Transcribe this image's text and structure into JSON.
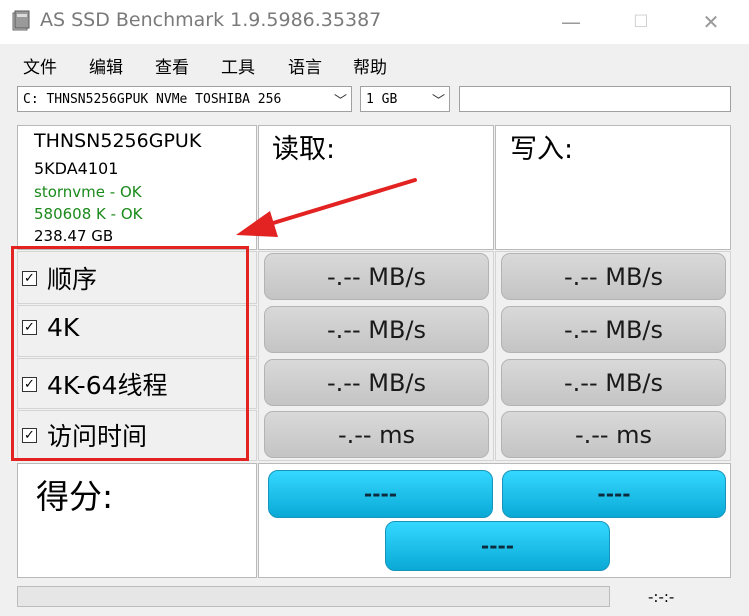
{
  "window": {
    "title": "AS SSD Benchmark 1.9.5986.35387",
    "minimize": "—",
    "maximize": "☐",
    "close": "✕"
  },
  "menu": [
    "文件",
    "编辑",
    "查看",
    "工具",
    "语言",
    "帮助"
  ],
  "toolbar": {
    "drive_select": "C: THNSN5256GPUK NVMe TOSHIBA 256",
    "size_select": "1 GB",
    "text_field": ""
  },
  "drive_info": {
    "model": "THNSN5256GPUK",
    "firmware": "5KDA4101",
    "driver_status": "stornvme - OK",
    "alignment_status": "580608 K - OK",
    "capacity": "238.47 GB"
  },
  "columns": {
    "read": "读取:",
    "write": "写入:"
  },
  "tests": [
    {
      "label": "顺序",
      "checked": true,
      "read": "-.-- MB/s",
      "write": "-.-- MB/s"
    },
    {
      "label": "4K",
      "checked": true,
      "read": "-.-- MB/s",
      "write": "-.-- MB/s"
    },
    {
      "label": "4K-64线程",
      "checked": true,
      "read": "-.-- MB/s",
      "write": "-.-- MB/s"
    },
    {
      "label": "访问时间",
      "checked": true,
      "read": "-.-- ms",
      "write": "-.-- ms"
    }
  ],
  "score": {
    "label": "得分:",
    "read": "----",
    "write": "----",
    "total": "----"
  },
  "status": {
    "time": "-:-:-"
  },
  "colors": {
    "ok_green": "#1a8a1a",
    "highlight_red": "#e32222",
    "score_blue": "#1cc4f0"
  }
}
